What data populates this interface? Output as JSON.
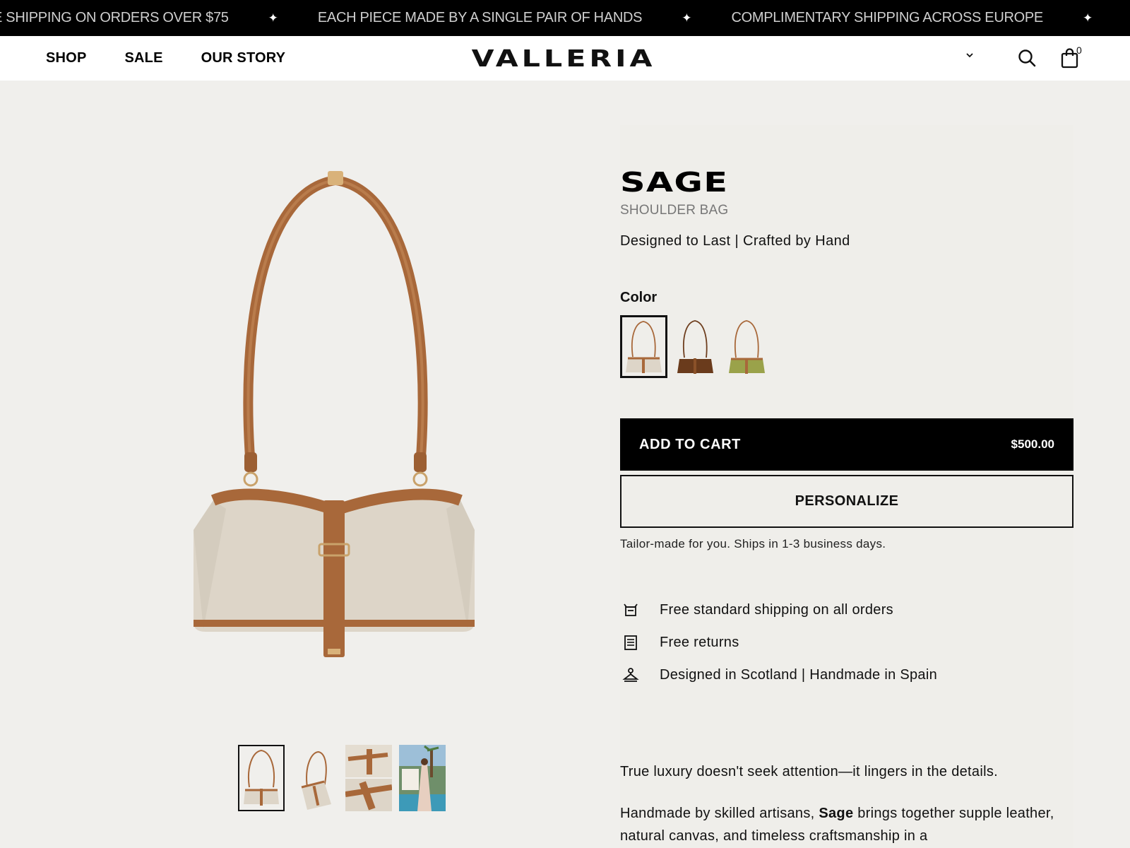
{
  "announcement": {
    "messages": [
      "E SHIPPING ON ORDERS OVER $75",
      "EACH PIECE MADE BY A SINGLE PAIR OF HANDS",
      "COMPLIMENTARY SHIPPING ACROSS EUROPE"
    ],
    "separator": "✦"
  },
  "header": {
    "nav": [
      "SHOP",
      "SALE",
      "OUR STORY"
    ],
    "logo": "VALLERIA",
    "cart_count": "0"
  },
  "product": {
    "name": "SAGE",
    "category": "SHOULDER BAG",
    "tagline": "Designed to Last | Crafted by Hand",
    "color_label": "Color",
    "colors": [
      "canvas-tan",
      "dark-brown",
      "olive-green"
    ],
    "add_to_cart_label": "ADD TO CART",
    "price": "$500.00",
    "personalize_label": "PERSONALIZE",
    "ship_note": "Tailor-made for you. Ships in 1-3 business days.",
    "features": [
      "Free standard shipping on all orders",
      "Free returns",
      "Designed in Scotland | Handmade in Spain"
    ],
    "description_1": "True luxury doesn't seek attention—it lingers in the details.",
    "description_2_pre": "Handmade by skilled artisans, ",
    "description_2_bold": "Sage",
    "description_2_post": " brings together supple leather, natural canvas, and timeless craftsmanship in a"
  },
  "colors": {
    "leather": "#a8683a",
    "canvas": "#ddd5c8",
    "black": "#000000"
  }
}
